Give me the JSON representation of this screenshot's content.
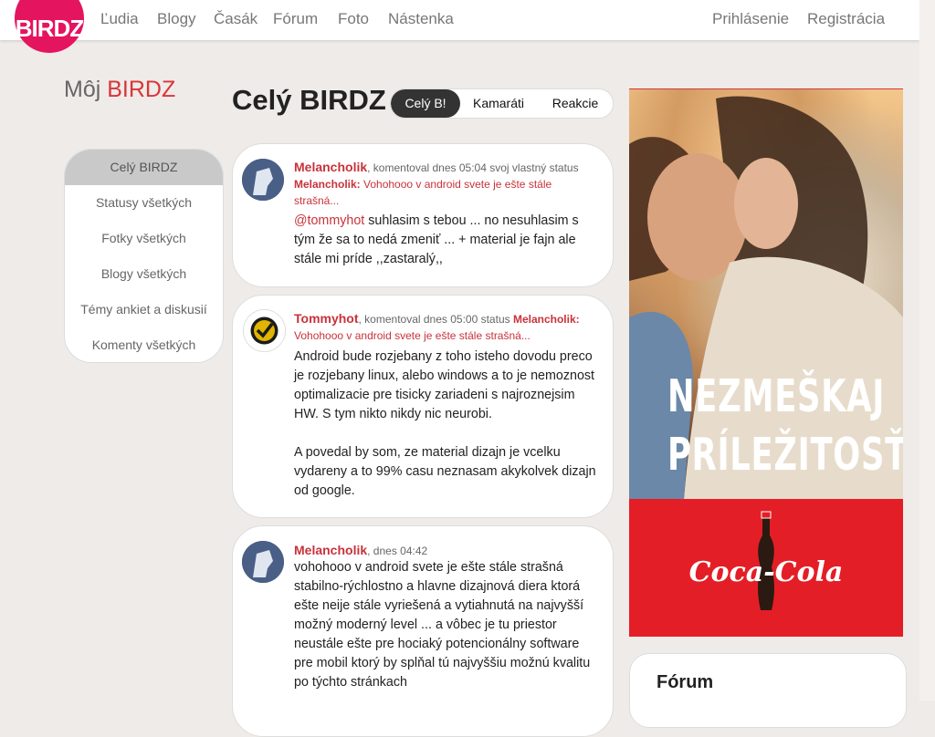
{
  "header": {
    "logo": "BIRDZ",
    "nav": [
      "Ľudia",
      "Blogy",
      "Časák",
      "Fórum",
      "Foto",
      "Nástenka"
    ],
    "auth": [
      "Prihlásenie",
      "Registrácia"
    ]
  },
  "sidebar": {
    "title_prefix": "Môj",
    "title_brand": "BIRDZ",
    "items": [
      "Celý BIRDZ",
      "Statusy všetkých",
      "Fotky všetkých",
      "Blogy všetkých",
      "Témy ankiet a diskusií",
      "Komenty všetkých"
    ],
    "active_index": 0
  },
  "feed": {
    "title": "Celý BIRDZ",
    "tabs": [
      "Celý B!",
      "Kamaráti",
      "Reakcie"
    ],
    "active_tab": 0
  },
  "posts": [
    {
      "author": "Melancholik",
      "action": ", komentoval dnes 05:04 svoj vlastný status",
      "quote_author": "Melancholik:",
      "quote_text": " Vohohooo v android svete je ešte stále strašná...",
      "mention": "@tommyhot",
      "body": " suhlasim s tebou ... no nesuhlasim s tým že sa to nedá zmeniť ... + material je fajn ale stále mi príde ,,zastaralý,,"
    },
    {
      "author": "Tommyhot",
      "action": ", komentoval dnes 05:00 status ",
      "quote_author": "Melancholik:",
      "quote_text": " Vohohooo v android svete je ešte stále strašná...",
      "body_p1": "Android bude rozjebany z toho isteho dovodu preco je rozjebany linux, alebo windows a to je nemoznost optimalizacie pre tisicky zariadeni s najroznejsim HW. S tym nikto nikdy nic neurobi.",
      "body_p2": "A povedal by som, ze material dizajn je vcelku vydareny a to 99% casu neznasam akykolvek dizajn od google."
    },
    {
      "author": "Melancholik",
      "action": ", dnes 04:42",
      "body": "vohohooo v android svete je ešte stále strašná stabilno-rýchlostno a hlavne dizajnová diera ktorá ešte neije stále vyriešená a vytiahnutá na najvyšší možný moderný level ... a vôbec je tu priestor neustále ešte pre hociaký potencionálny software pre mobil ktorý by splňal tú najvyššiu možnú kvalitu po týchto stránkach"
    }
  ],
  "ad": {
    "line1": "NEZMEŠKAJ",
    "line2": "PRÍLEŽITOSŤ.",
    "brand": "Coca-Cola"
  },
  "widgets": {
    "forum_title": "Fórum"
  }
}
